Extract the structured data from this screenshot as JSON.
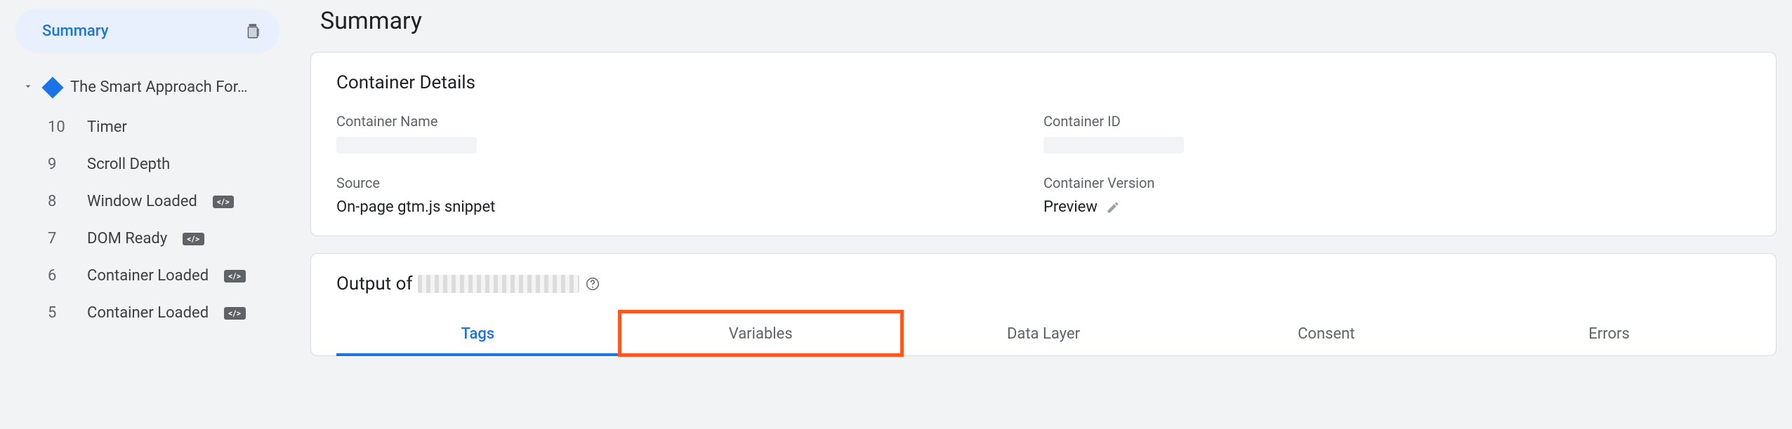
{
  "sidebar": {
    "summary_label": "Summary",
    "page_name": "The Smart Approach For…",
    "events": [
      {
        "num": "10",
        "label": "Timer",
        "badge": null
      },
      {
        "num": "9",
        "label": "Scroll Depth",
        "badge": null
      },
      {
        "num": "8",
        "label": "Window Loaded",
        "badge": "</>"
      },
      {
        "num": "7",
        "label": "DOM Ready",
        "badge": "</>"
      },
      {
        "num": "6",
        "label": "Container Loaded",
        "badge": "</>"
      },
      {
        "num": "5",
        "label": "Container Loaded",
        "badge": "</>"
      }
    ]
  },
  "main": {
    "title": "Summary",
    "container_details": {
      "heading": "Container Details",
      "name_label": "Container Name",
      "id_label": "Container ID",
      "source_label": "Source",
      "source_value": "On-page gtm.js snippet",
      "version_label": "Container Version",
      "version_value": "Preview"
    },
    "output": {
      "heading_prefix": "Output of",
      "tabs": [
        "Tags",
        "Variables",
        "Data Layer",
        "Consent",
        "Errors"
      ],
      "active_tab_index": 0,
      "highlighted_tab_index": 1
    }
  }
}
